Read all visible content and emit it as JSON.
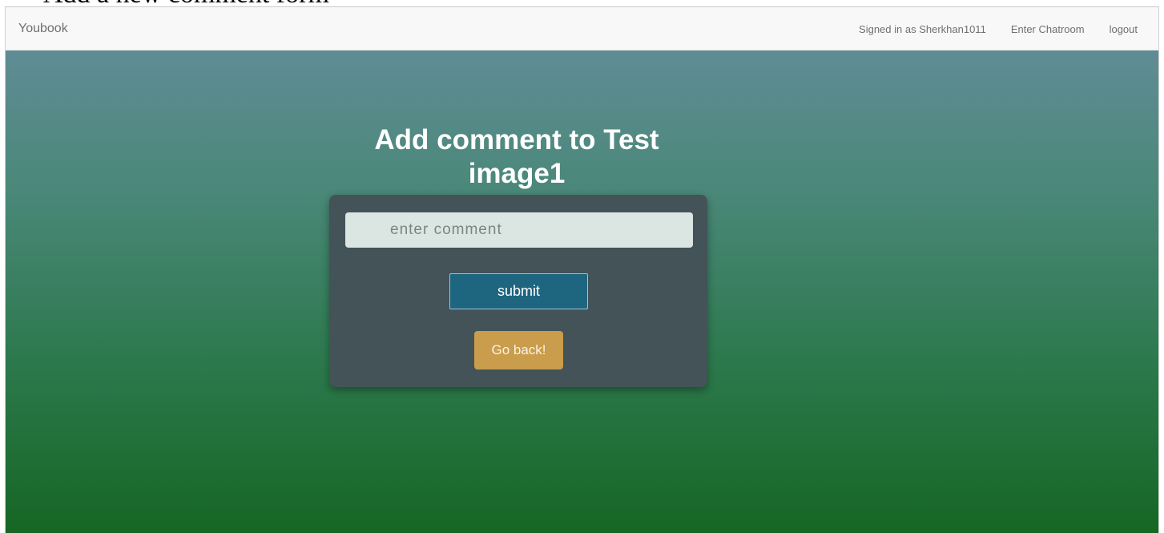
{
  "caption": "Add a new comment form",
  "navbar": {
    "brand": "Youbook",
    "signed_in": "Signed in as Sherkhan1011",
    "chatroom": "Enter Chatroom",
    "logout": "logout"
  },
  "main": {
    "title": "Add comment to Test image1",
    "comment_placeholder": "enter comment",
    "submit_label": "submit",
    "back_label": "Go back!"
  },
  "colors": {
    "navbar_bg": "#f8f8f8",
    "card_bg": "#435358",
    "submit_bg": "#1e6580",
    "back_bg": "#c99d4c",
    "gradient_top": "#5f8c94",
    "gradient_bottom": "#166624"
  }
}
